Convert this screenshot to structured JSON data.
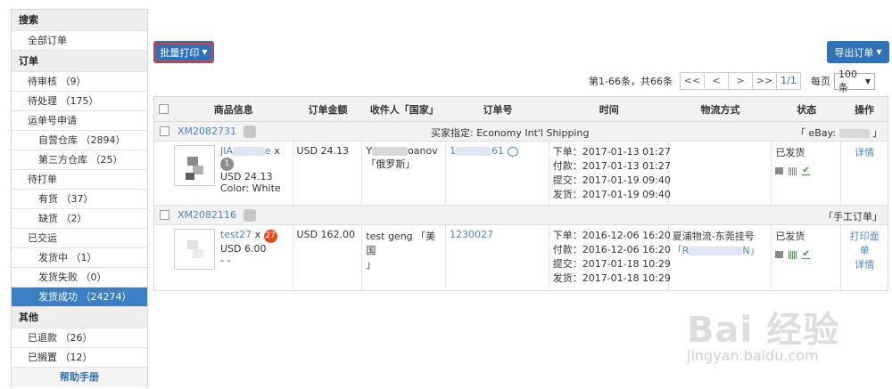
{
  "sidebar": {
    "search_title": "搜索",
    "all_orders": "全部订单",
    "orders_title": "订单",
    "pending_review": "待审核 （9）",
    "pending_process": "待处理 （175）",
    "waybill_apply": "运单号申请",
    "own_warehouse": "自营仓库 （2894）",
    "third_warehouse": "第三方仓库 （25）",
    "pending_print": "待打单",
    "in_stock": "有货 （37）",
    "out_of_stock": "缺货 （2）",
    "shipped_title": "已交运",
    "shipping": "发货中 （1）",
    "ship_failed": "发货失败 （0）",
    "ship_success": "发货成功 （24274）",
    "other_title": "其他",
    "refunded": "已退款 （26）",
    "shelved": "已搁置 （12）",
    "help": "帮助手册"
  },
  "toolbar": {
    "batch_print": "批量打印",
    "export_orders": "导出订单"
  },
  "pager": {
    "info": "第1-66条，共66条",
    "first": "<<",
    "prev": "<",
    "next": ">",
    "last": ">>",
    "page": "1/1",
    "per_page_label": "每页",
    "per_page_value": "100条"
  },
  "table": {
    "headers": [
      "商品信息",
      "订单金额",
      "收件人「国家」",
      "订单号",
      "时间",
      "物流方式",
      "状态",
      "操作"
    ]
  },
  "orders": [
    {
      "order_no": "XM2082731",
      "buyer_shipping": "买家指定: Economy Int'l Shipping",
      "source_prefix": "「 eBay:",
      "source_suffix": "」",
      "goods_title_a": "JIA",
      "goods_title_b": "e",
      "goods_x": "x",
      "qty": "1",
      "goods_price": "USD 24.13",
      "goods_color": "Color: White",
      "amount": "USD 24.13",
      "recipient_a": "Y",
      "recipient_b": "oanov",
      "country": "「俄罗斯」",
      "order_id_a": "1",
      "order_id_b": "61",
      "times": [
        "下单：2017-01-13 01:27",
        "付款：2017-01-13 01:27",
        "提交：2017-01-19 09:40",
        "发货：2017-01-19 09:40"
      ],
      "logistics": "",
      "status": "已发货",
      "op1": "详情"
    },
    {
      "order_no": "XM2082116",
      "source": "「手工订单」",
      "goods_title": "test27",
      "goods_x": "x",
      "qty": "27",
      "goods_price": "USD 6.00",
      "goods_extra": "- -",
      "amount": "USD 162.00",
      "recipient": "test geng",
      "country_a": "「美国",
      "country_b": "」",
      "order_id": "1230027",
      "times": [
        "下单：2016-12-06 16:20",
        "付款：2016-12-06 16:20",
        "提交：2017-01-18 10:29",
        "发货：2017-01-18 10:29"
      ],
      "logistics": "夏浦物流-东莞挂号",
      "tracking_a": "「R",
      "tracking_b": "N」",
      "status": "已发货",
      "op1": "打印面单",
      "op2": "详情"
    }
  ],
  "watermark": {
    "text": "Bai 经验",
    "sub": "jingyan.baidu.com"
  }
}
